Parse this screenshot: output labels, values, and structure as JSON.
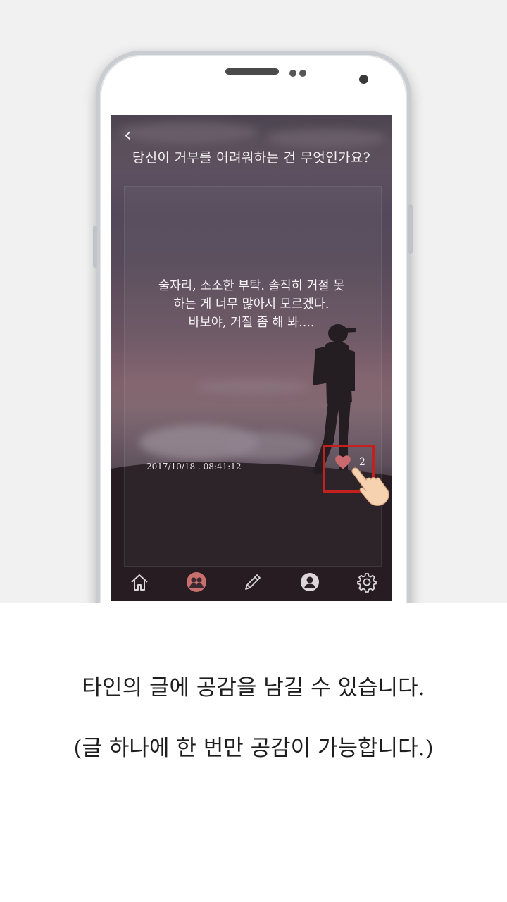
{
  "screen": {
    "question": "당신이 거부를 어려워하는 건 무엇인가요?",
    "body_lines": [
      "술자리, 소소한 부탁. 솔직히 거절 못",
      "하는 게 너무 많아서 모르겠다.",
      "바보야, 거절 좀 해 봐...."
    ],
    "timestamp": "2017/10/18 . 08:41:12",
    "like_count": "2",
    "back_icon": "chevron-left-icon",
    "colors": {
      "highlight_box": "#c3201e",
      "heart": "#c96a6e",
      "active_tab": "#c9706e"
    }
  },
  "tabbar": {
    "items": [
      {
        "icon": "home-icon",
        "active": false
      },
      {
        "icon": "community-icon",
        "active": true
      },
      {
        "icon": "pencil-icon",
        "active": false
      },
      {
        "icon": "profile-icon",
        "active": false
      },
      {
        "icon": "gear-icon",
        "active": false
      }
    ]
  },
  "captions": {
    "line1": "타인의 글에 공감을 남길 수 있습니다.",
    "line2": "(글 하나에 한 번만 공감이 가능합니다.)"
  }
}
